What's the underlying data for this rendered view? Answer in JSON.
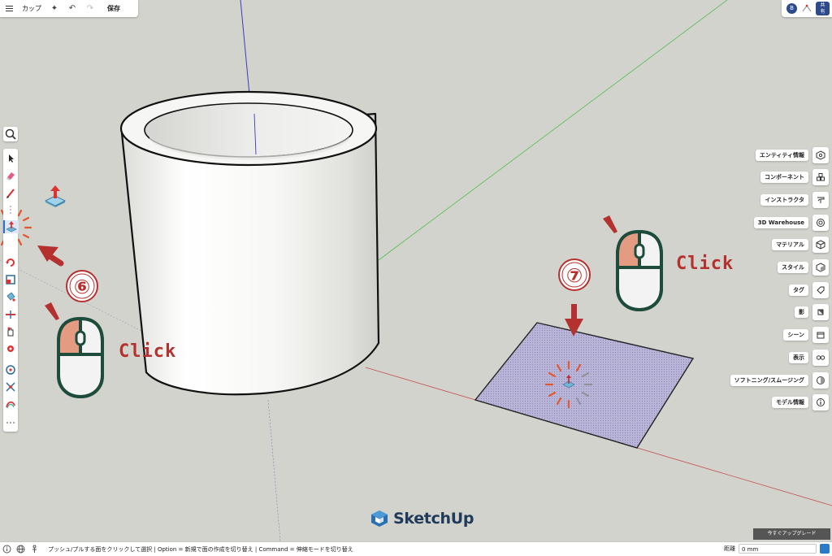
{
  "toolbar": {
    "doc_title": "カップ",
    "save_label": "保存"
  },
  "share": {
    "label_line1": "共",
    "label_line2": "有"
  },
  "profile": {
    "initial": "B"
  },
  "right_panels": [
    {
      "label": "エンティティ情報",
      "icon": "entity-info-icon"
    },
    {
      "label": "コンポーネント",
      "icon": "components-icon"
    },
    {
      "label": "インストラクタ",
      "icon": "instructor-icon"
    },
    {
      "label": "3D Warehouse",
      "icon": "warehouse-icon"
    },
    {
      "label": "マテリアル",
      "icon": "materials-icon"
    },
    {
      "label": "スタイル",
      "icon": "styles-icon"
    },
    {
      "label": "タグ",
      "icon": "tags-icon"
    },
    {
      "label": "影",
      "icon": "shadows-icon"
    },
    {
      "label": "シーン",
      "icon": "scenes-icon"
    },
    {
      "label": "表示",
      "icon": "display-icon"
    },
    {
      "label": "ソフトニング/スムージング",
      "icon": "soften-icon"
    },
    {
      "label": "モデル情報",
      "icon": "model-info-icon"
    }
  ],
  "annotations": {
    "step6": "⑥",
    "step7": "⑦",
    "click1": "Click",
    "click2": "Click"
  },
  "logo": {
    "text": "SketchUp"
  },
  "upgrade": {
    "label": "今すぐアップグレード"
  },
  "statusbar": {
    "text": "プッシュ/プルする面をクリックして選択 | Option = 新規で面の作成を切り替え | Command = 伸縮モードを切り替え",
    "measure_label": "距離",
    "measure_value": "0 mm"
  },
  "colors": {
    "background": "#d3d3cd",
    "accent_red": "#b5312f",
    "mouse_outline": "#1e4c3c",
    "mouse_fill": "#e59a82",
    "face_fill": "#b7b3d6",
    "brand": "#1f3a5a"
  }
}
